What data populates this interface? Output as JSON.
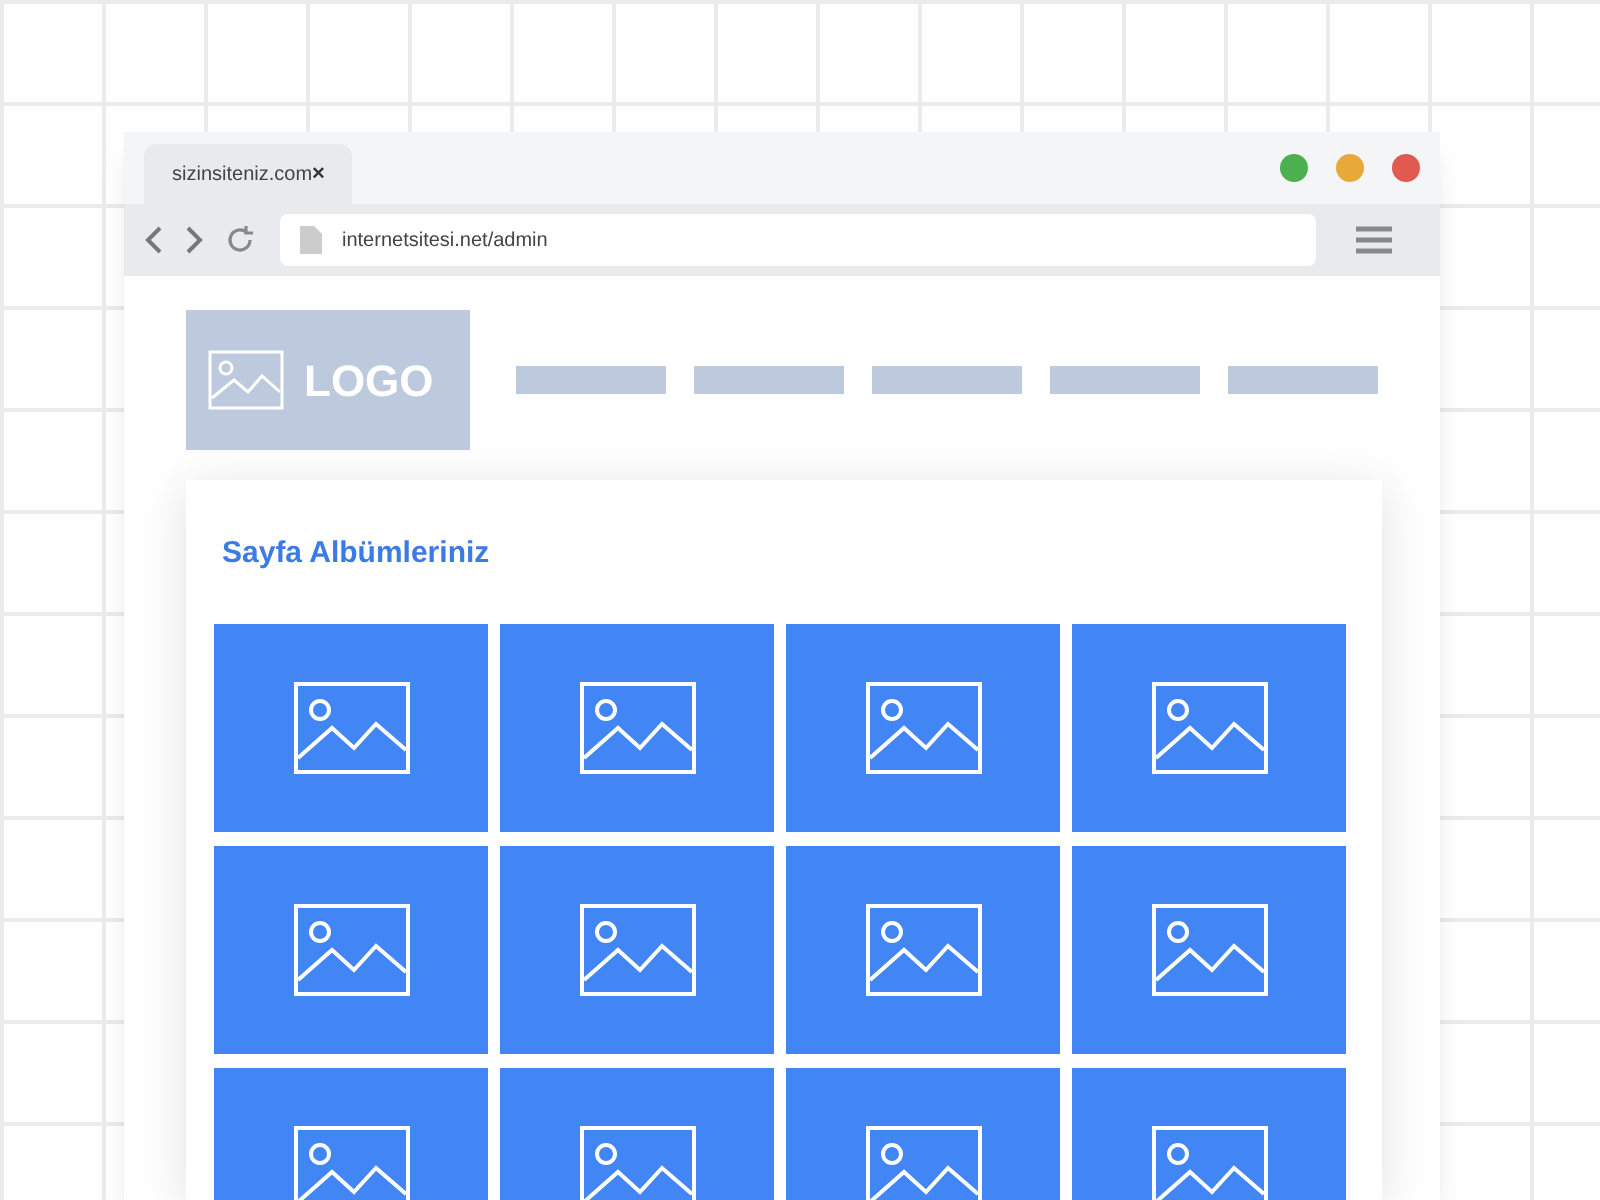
{
  "window_controls": [
    {
      "color": "#4caf50"
    },
    {
      "color": "#e8a93a"
    },
    {
      "color": "#e05a4f"
    }
  ],
  "tab": {
    "title": "sizinsiteniz.com",
    "close": "×"
  },
  "address_bar": {
    "url": "internetsitesi.net/admin"
  },
  "logo": {
    "text": "LOGO"
  },
  "album_card": {
    "title": "Sayfa Albümleriniz"
  }
}
